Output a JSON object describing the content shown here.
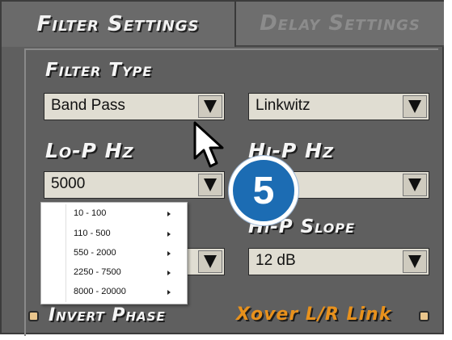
{
  "tabs": {
    "filter_settings": "Filter Settings",
    "delay_settings": "Delay Settings"
  },
  "filter_type": {
    "label": "Filter Type",
    "left_value": "Band Pass",
    "right_value": "Linkwitz"
  },
  "lo_p": {
    "label": "Lo-P  Hz",
    "value": "5000"
  },
  "hi_p": {
    "label": "Hi-P  Hz",
    "value": ""
  },
  "hi_p_slope": {
    "label": "Hi-P Slope",
    "value": "12 dB"
  },
  "frequency_menu": {
    "items": [
      "10 - 100",
      "110 - 500",
      "550 - 2000",
      "2250 - 7500",
      "8000 - 20000"
    ]
  },
  "options": {
    "invert_phase": "Invert Phase",
    "xover_link": "Xover L/R Link"
  },
  "step_badge": "5",
  "colors": {
    "panel": "#5f5f5f",
    "combo_bg": "#e0ddd2",
    "badge_blue": "#1c6cb3",
    "xover_text": "#e8911c"
  },
  "icons": {
    "dropdown": "triangle-down-icon",
    "submenu": "chevron-right-icon",
    "pointer": "mouse-pointer-icon"
  }
}
